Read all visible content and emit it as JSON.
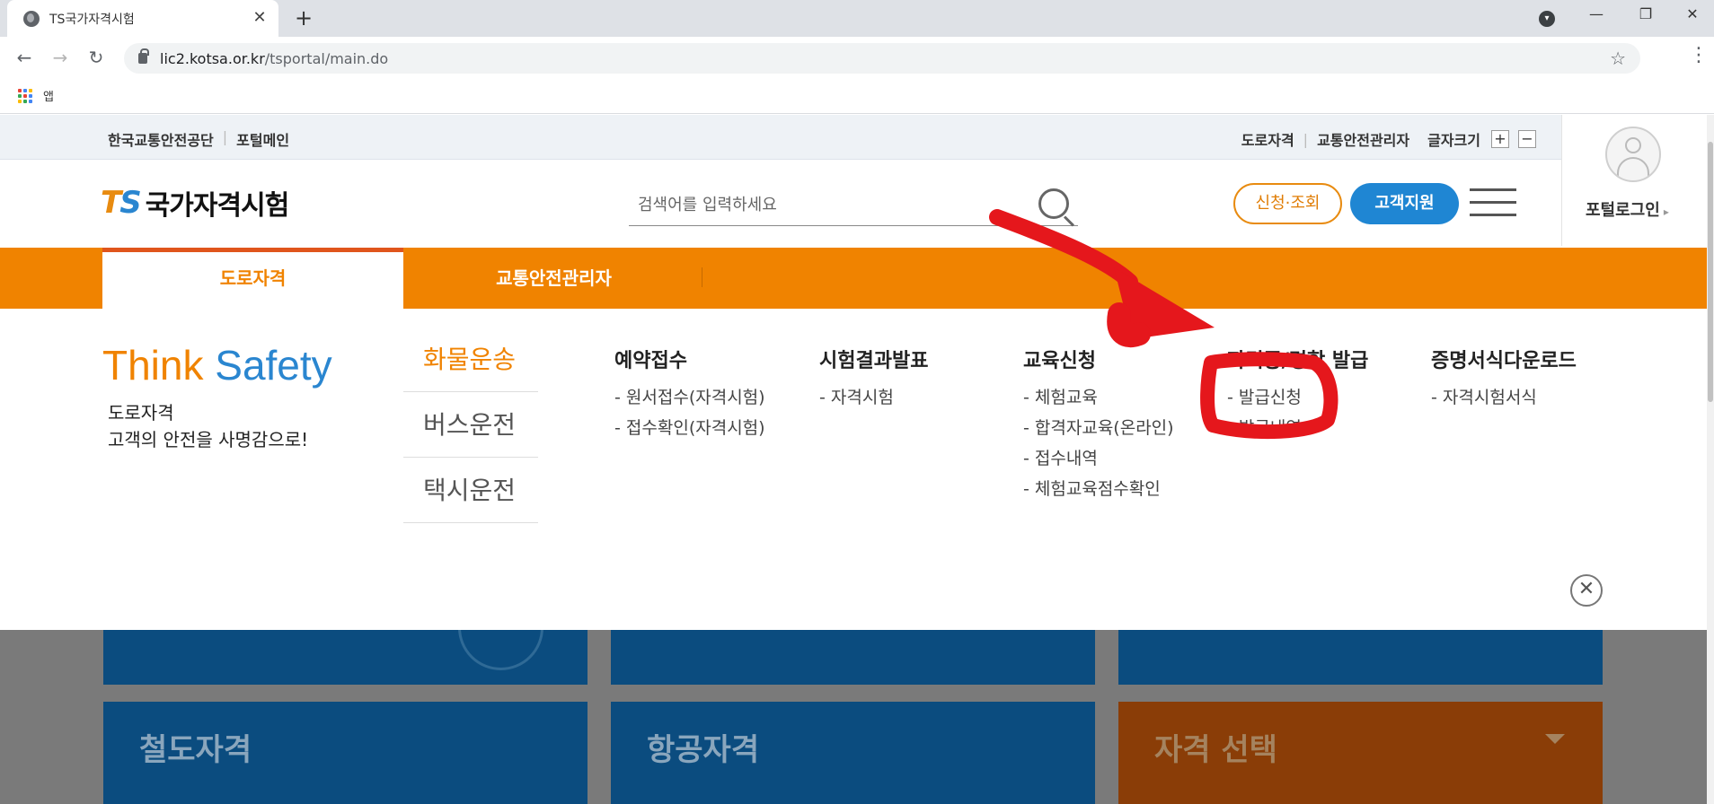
{
  "browser": {
    "tab_title": "TS국가자격시험",
    "url_host": "lic2.kotsa.or.kr",
    "url_path": "/tsportal/main.do",
    "bookmarks_label": "앱"
  },
  "util": {
    "left": [
      "한국교통안전공단",
      "포털메인"
    ],
    "right": [
      "도로자격",
      "교통안전관리자"
    ],
    "font_size_label": "글자크기",
    "font_plus": "+",
    "font_minus": "−"
  },
  "login": {
    "label": "포털로그인"
  },
  "header": {
    "logo_ts_t": "T",
    "logo_ts_s": "S",
    "logo_name": "국가자격시험",
    "search_placeholder": "검색어를 입력하세요",
    "apply_button": "신청·조회",
    "support_button": "고객지원"
  },
  "gnb": {
    "active_tab": "도로자격",
    "tab2": "교통안전관리자"
  },
  "mega": {
    "think": "Think",
    "safety": "Safety",
    "slogan_line1": "도로자격",
    "slogan_line2": "고객의 안전을 사명감으로!",
    "categories": [
      "화물운송",
      "버스운전",
      "택시운전"
    ],
    "columns": [
      {
        "title": "예약접수",
        "links": [
          "- 원서접수(자격시험)",
          "- 접수확인(자격시험)"
        ]
      },
      {
        "title": "시험결과발표",
        "links": [
          "- 자격시험"
        ]
      },
      {
        "title": "교육신청",
        "links": [
          "- 체험교육",
          "- 합격자교육(온라인)",
          "- 접수내역",
          "- 체험교육점수확인"
        ]
      },
      {
        "title": "자격증/명함 발급",
        "links": [
          "- 발급신청",
          "- 발급내역"
        ]
      },
      {
        "title": "증명서식다운로드",
        "links": [
          "- 자격시험서식"
        ]
      }
    ]
  },
  "cards": {
    "rail": "철도자격",
    "aviation": "항공자격",
    "select": "자격 선택"
  },
  "colors": {
    "orange": "#f08300",
    "blue": "#1f86d3",
    "annotation_red": "#e5171c"
  }
}
